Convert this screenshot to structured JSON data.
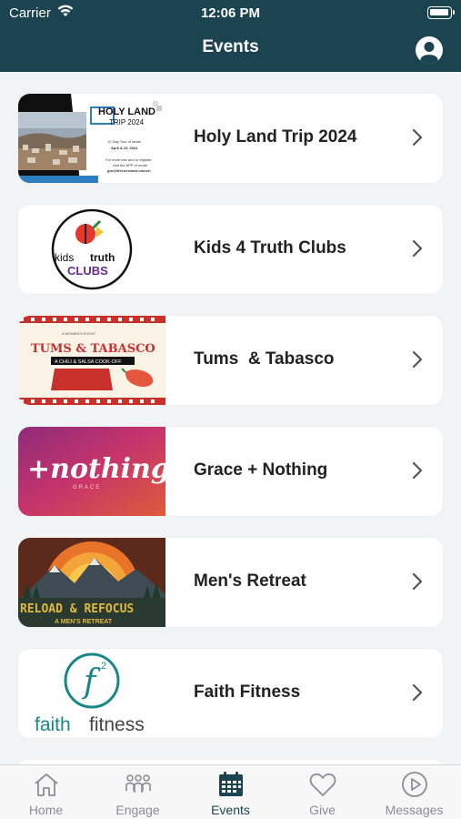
{
  "status_bar": {
    "carrier": "Carrier",
    "time": "12:06 PM"
  },
  "nav": {
    "title": "Events"
  },
  "events": [
    {
      "title": "Holy Land Trip 2024",
      "thumb": {
        "heading": "HOLY LAND",
        "subheading": "TRIP 2024",
        "line1": "12 Day Tour of Israel",
        "line2": "April 8-19, 2024",
        "line3": "For more info and to register,",
        "line4": "visit the APP or email",
        "line5": "gm@lifecovenant.church"
      }
    },
    {
      "title": "Kids 4 Truth Clubs",
      "thumb": {
        "word1": "kids",
        "word2": "truth",
        "word3": "CLUBS"
      }
    },
    {
      "title": "Tums  & Tabasco",
      "thumb": {
        "kicker": "A WOMEN'S EVENT",
        "heading": "TUMS & TABASCO",
        "banner": "A CHILI & SALSA COOK-OFF"
      }
    },
    {
      "title": "Grace + Nothing",
      "thumb": {
        "heading": "+nothing",
        "sub": "GRACE"
      }
    },
    {
      "title": "Men's Retreat",
      "thumb": {
        "heading": "RELOAD & REFOCUS",
        "sub": "A MEN'S RETREAT"
      }
    },
    {
      "title": "Faith Fitness",
      "thumb": {
        "logo_letter": "f",
        "logo_sup": "2",
        "word1": "faith",
        "word2": "fitness"
      }
    }
  ],
  "tabs": [
    {
      "label": "Home",
      "icon": "home-icon"
    },
    {
      "label": "Engage",
      "icon": "people-icon"
    },
    {
      "label": "Events",
      "icon": "calendar-icon",
      "active": true
    },
    {
      "label": "Give",
      "icon": "heart-icon"
    },
    {
      "label": "Messages",
      "icon": "play-icon"
    }
  ],
  "colors": {
    "header": "#1c4450",
    "active_tab": "#1c4450",
    "inactive_tab": "#8e8e93",
    "background": "#f2f3f5"
  }
}
